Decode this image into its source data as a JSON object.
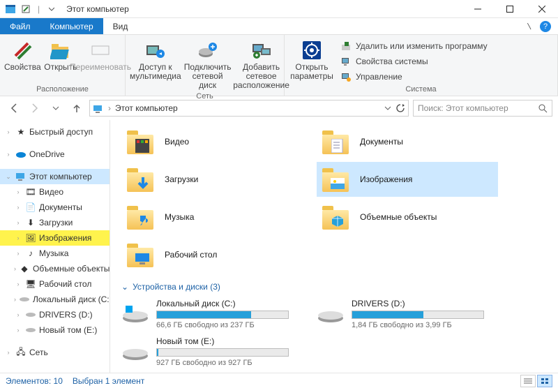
{
  "window": {
    "title": "Этот компьютер"
  },
  "tabs": {
    "file": "Файл",
    "computer": "Компьютер",
    "view": "Вид"
  },
  "ribbon": {
    "location": {
      "properties": "Свойства",
      "open": "Открыть",
      "rename": "Переименовать",
      "group": "Расположение"
    },
    "network": {
      "media": "Доступ к мультимедиа",
      "map_drive": "Подключить сетевой диск",
      "add_location": "Добавить сетевое расположение",
      "group": "Сеть"
    },
    "system": {
      "open_params": "Открыть параметры",
      "uninstall": "Удалить или изменить программу",
      "sys_props": "Свойства системы",
      "manage": "Управление",
      "group": "Система"
    }
  },
  "nav": {
    "breadcrumb": "Этот компьютер",
    "search_placeholder": "Поиск: Этот компьютер"
  },
  "tree": {
    "quick": "Быстрый доступ",
    "onedrive": "OneDrive",
    "thispc": "Этот компьютер",
    "video": "Видео",
    "documents": "Документы",
    "downloads": "Загрузки",
    "pictures": "Изображения",
    "music": "Музыка",
    "objects3d": "Объемные объекты",
    "desktop": "Рабочий стол",
    "localdisk": "Локальный диск (C:)",
    "drivers": "DRIVERS (D:)",
    "newvol": "Новый том (E:)",
    "network": "Сеть"
  },
  "folders": {
    "video": "Видео",
    "documents": "Документы",
    "downloads": "Загрузки",
    "pictures": "Изображения",
    "music": "Музыка",
    "objects3d": "Объемные объекты",
    "desktop": "Рабочий стол"
  },
  "drives_section": "Устройства и диски (3)",
  "drives": {
    "c": {
      "name": "Локальный диск (C:)",
      "free": "66,6 ГБ свободно из 237 ГБ",
      "pct": 72
    },
    "d": {
      "name": "DRIVERS (D:)",
      "free": "1,84 ГБ свободно из 3,99 ГБ",
      "pct": 54
    },
    "e": {
      "name": "Новый том (E:)",
      "free": "927 ГБ свободно из 927 ГБ",
      "pct": 1
    }
  },
  "status": {
    "count": "Элементов: 10",
    "selected": "Выбран 1 элемент"
  }
}
